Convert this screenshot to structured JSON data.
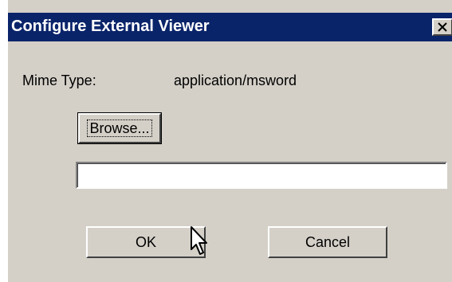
{
  "dialog": {
    "title": "Configure External Viewer",
    "close_icon": "close-icon"
  },
  "mime": {
    "label": "Mime Type:",
    "value": "application/msword"
  },
  "browse_button": {
    "label": "Browse..."
  },
  "path_field": {
    "value": ""
  },
  "ok_button": {
    "label": "OK"
  },
  "cancel_button": {
    "label": "Cancel"
  }
}
